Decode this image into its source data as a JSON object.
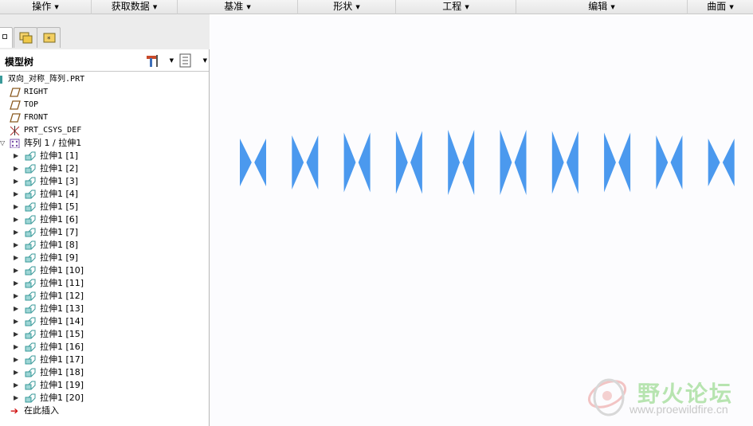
{
  "menubar": {
    "items": [
      {
        "label": "操作"
      },
      {
        "label": "获取数据"
      },
      {
        "label": "基准"
      },
      {
        "label": "形状"
      },
      {
        "label": "工程"
      },
      {
        "label": "编辑"
      },
      {
        "label": "曲面"
      }
    ]
  },
  "left_tabs": {
    "items": [
      {
        "icon": "model-tree-icon"
      },
      {
        "icon": "folder-browser-icon"
      },
      {
        "icon": "favorites-icon"
      }
    ]
  },
  "tree": {
    "title": "模型树",
    "root": "双向_对称_阵列.PRT",
    "datums": [
      {
        "label": "RIGHT",
        "icon": "datum-plane-icon"
      },
      {
        "label": "TOP",
        "icon": "datum-plane-icon"
      },
      {
        "label": "FRONT",
        "icon": "datum-plane-icon"
      },
      {
        "label": "PRT_CSYS_DEF",
        "icon": "csys-icon"
      }
    ],
    "pattern": "阵列 1 / 拉伸1",
    "extrudes": [
      "拉伸1 [1]",
      "拉伸1 [2]",
      "拉伸1 [3]",
      "拉伸1 [4]",
      "拉伸1 [5]",
      "拉伸1 [6]",
      "拉伸1 [7]",
      "拉伸1 [8]",
      "拉伸1 [9]",
      "拉伸1 [10]",
      "拉伸1 [11]",
      "拉伸1 [12]",
      "拉伸1 [13]",
      "拉伸1 [14]",
      "拉伸1 [15]",
      "拉伸1 [16]",
      "拉伸1 [17]",
      "拉伸1 [18]",
      "拉伸1 [19]",
      "拉伸1 [20]"
    ],
    "insert_here": "在此插入"
  },
  "graphics": {
    "bowtie_color": "#4b99ee",
    "bowtie_count": 10,
    "watermark": {
      "title": "野火论坛",
      "url": "www.proewildfire.cn"
    }
  },
  "colors": {
    "insert_arrow": "#d01010",
    "feature_icon": "#3a9a9a",
    "pattern_icon": "#7a4fa8"
  }
}
